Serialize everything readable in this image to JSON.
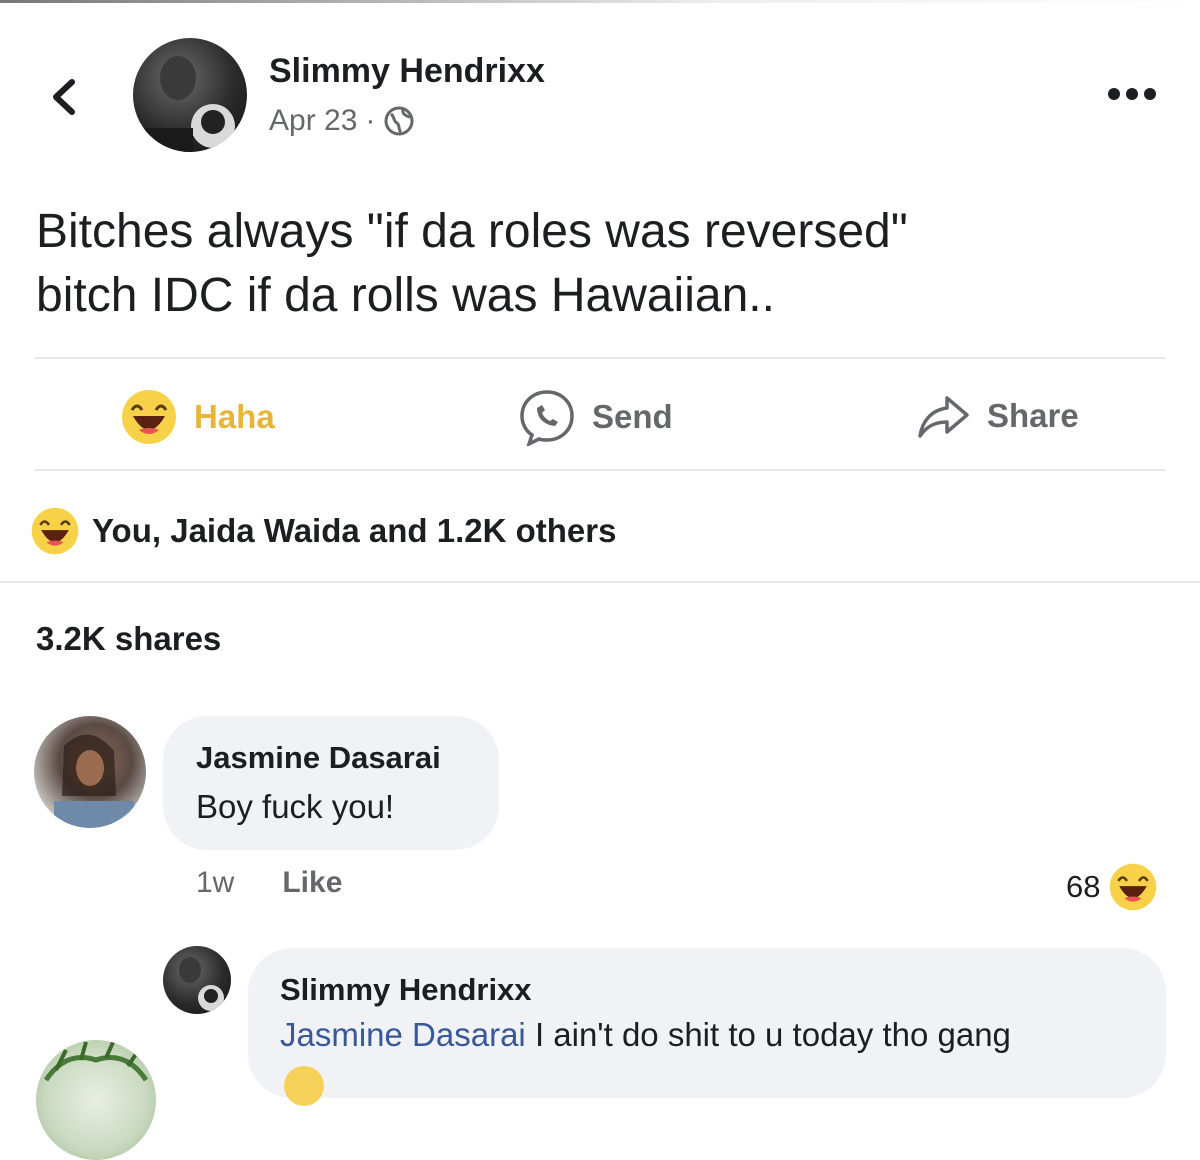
{
  "post": {
    "author": "Slimmy Hendrixx",
    "date": "Apr 23",
    "separator": "·",
    "text_line1": "Bitches always \"if da roles was reversed\"",
    "text_line2": "bitch IDC if da rolls was Hawaiian.."
  },
  "actions": {
    "haha_label": "Haha",
    "send_label": "Send",
    "share_label": "Share"
  },
  "reactions": {
    "summary": "You, Jaida Waida and 1.2K others"
  },
  "shares": {
    "label": "3.2K shares"
  },
  "comments": [
    {
      "name": "Jasmine Dasarai",
      "text": "Boy fuck you!",
      "time": "1w",
      "like_label": "Like",
      "reaction_count": "68"
    }
  ],
  "reply": {
    "name": "Slimmy Hendrixx",
    "mention": "Jasmine Dasarai",
    "text": "I ain't do shit to u today tho gang"
  },
  "icons": {
    "back": "chevron-left-icon",
    "globe": "globe-icon",
    "more": "more-dots-icon",
    "haha": "haha-emoji-icon",
    "send": "messenger-icon",
    "share": "share-arrow-icon"
  },
  "colors": {
    "meta_gray": "#65676b",
    "haha_yellow": "#e8b53a",
    "mention_blue": "#385898",
    "bubble_bg": "#f0f2f5"
  }
}
